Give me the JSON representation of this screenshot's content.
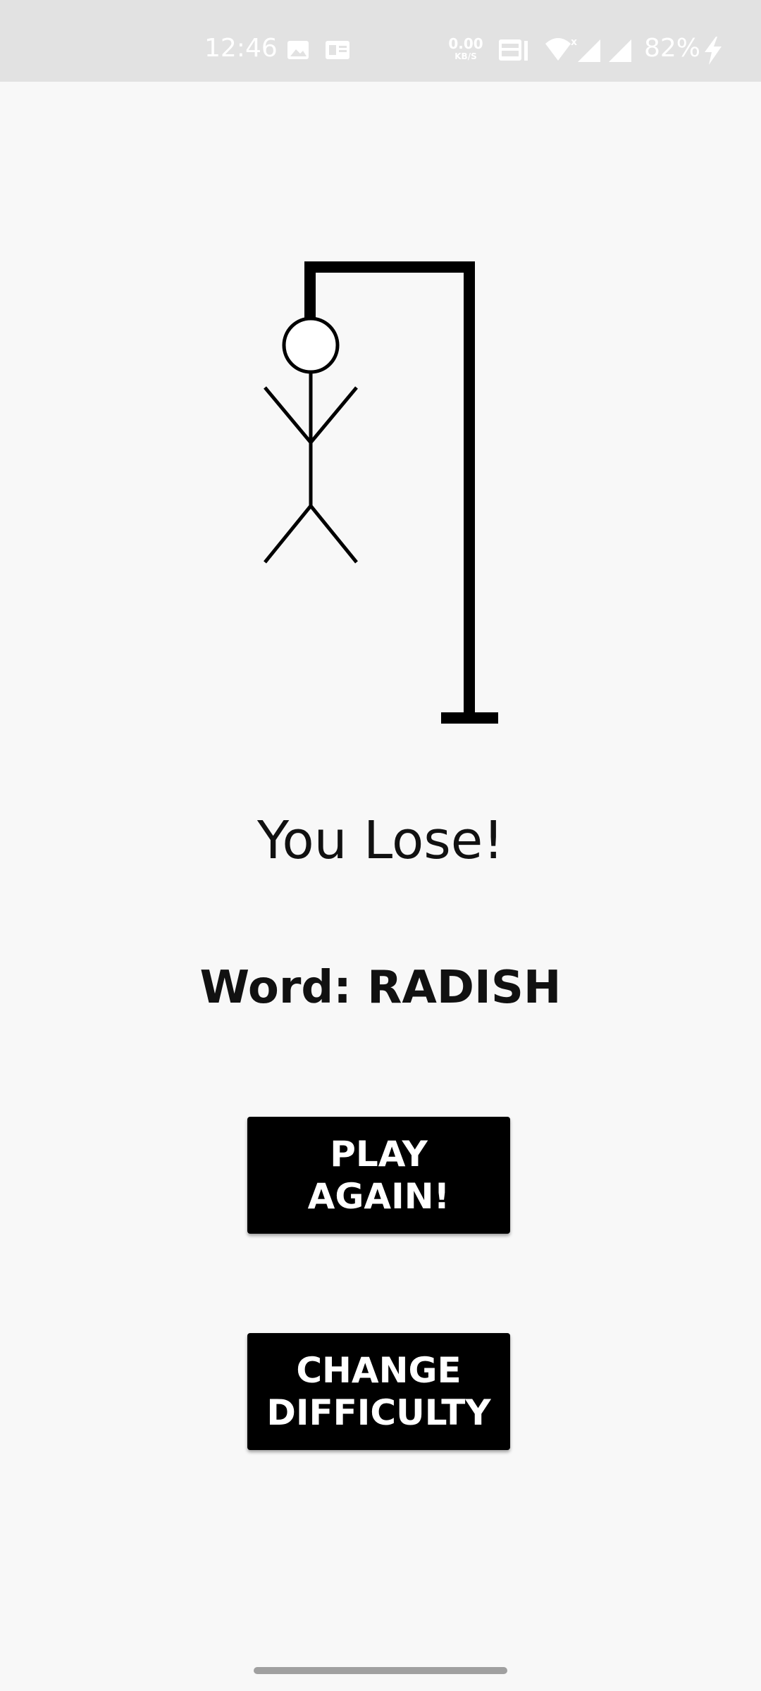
{
  "status_bar": {
    "time": "12:46",
    "net_speed_value": "0.00",
    "net_speed_unit": "KB/S",
    "battery_percent": "82%",
    "icons": [
      "image-icon",
      "sim-card-icon",
      "volte-icon",
      "wifi-icon",
      "signal-icon",
      "signal-icon",
      "charging-bolt-icon"
    ]
  },
  "game": {
    "result": "You Lose!",
    "word_line": "Word: RADISH"
  },
  "buttons": {
    "play_again": "PLAY\nAGAIN!",
    "change_difficulty": "CHANGE\nDIFFICULTY"
  }
}
